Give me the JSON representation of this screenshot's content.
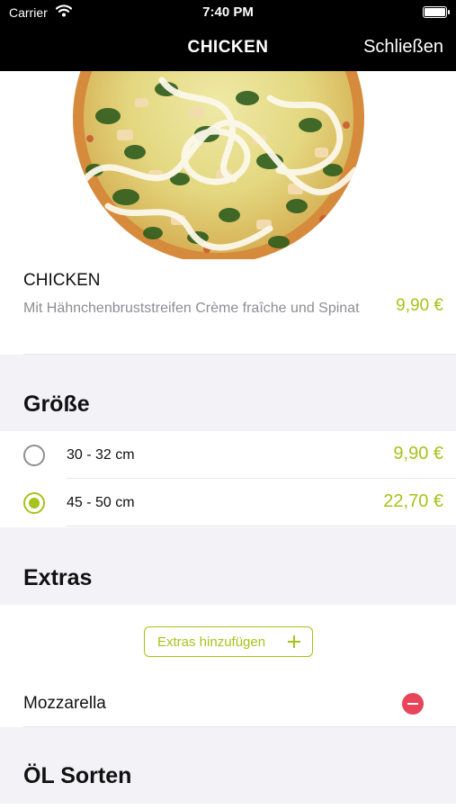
{
  "status_bar": {
    "carrier": "Carrier",
    "time": "7:40 PM"
  },
  "nav": {
    "title": "CHICKEN",
    "close_label": "Schließen"
  },
  "product": {
    "name": "CHICKEN",
    "description": "Mit Hähnchenbruststreifen Crème fraîche und Spinat",
    "price": "9,90 €"
  },
  "sections": {
    "size": "Größe",
    "extras": "Extras",
    "oil": "ÖL Sorten"
  },
  "size_options": [
    {
      "label": "30 - 32 cm",
      "price": "9,90 €",
      "selected": false
    },
    {
      "label": "45 - 50 cm",
      "price": "22,70 €",
      "selected": true
    }
  ],
  "extras": {
    "add_button_label": "Extras hinzufügen",
    "items": [
      {
        "label": "Mozzarella"
      }
    ]
  },
  "colors": {
    "accent": "#a5c31a",
    "remove": "#e8455a",
    "bar": "#000000",
    "section_bg": "#f2f2f7"
  },
  "icons": [
    "wifi-icon",
    "battery-icon",
    "radio-icon",
    "plus-icon",
    "remove-icon"
  ]
}
